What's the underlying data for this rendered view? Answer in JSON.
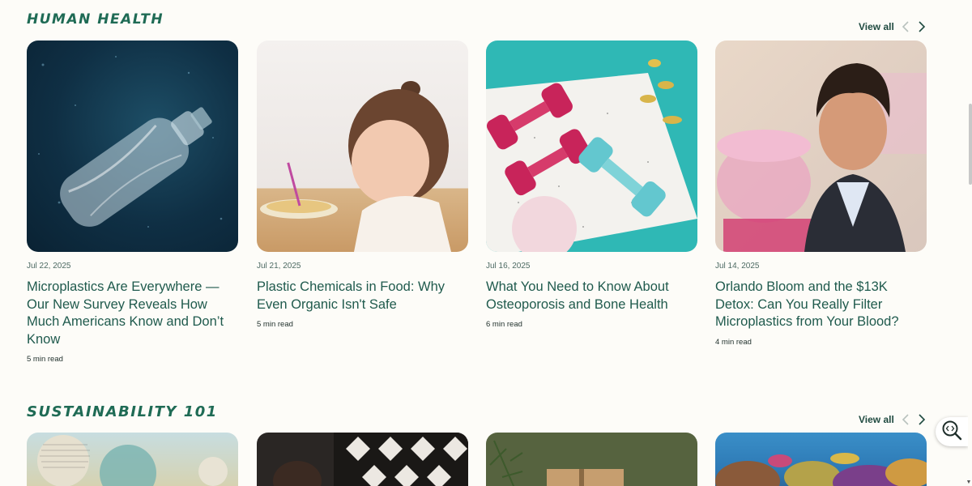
{
  "sections": [
    {
      "title": "HUMAN HEALTH",
      "view_all": "View all",
      "cards": [
        {
          "date": "Jul 22, 2025",
          "title": "Microplastics Are Everywhere — Our New Survey Reveals How Much Americans Know and Don’t Know",
          "read": "5 min read",
          "image": "plastic-bottle-underwater"
        },
        {
          "date": "Jul 21, 2025",
          "title": "Plastic Chemicals in Food: Why Even Organic Isn't Safe",
          "read": "5 min read",
          "image": "toddler-eating"
        },
        {
          "date": "Jul 16, 2025",
          "title": "What You Need to Know About Osteoporosis and Bone Health",
          "read": "6 min read",
          "image": "dumbbells-supplements"
        },
        {
          "date": "Jul 14, 2025",
          "title": "Orlando Bloom and the $13K Detox: Can You Really Filter Microplastics from Your Blood?",
          "read": "4 min read",
          "image": "man-portrait-containers"
        }
      ]
    },
    {
      "title": "SUSTAINABILITY 101",
      "view_all": "View all",
      "cards": [
        {
          "image": "newspaper-collage"
        },
        {
          "image": "knit-sweater"
        },
        {
          "image": "wrapped-gift-pine"
        },
        {
          "image": "coral-reef"
        }
      ]
    }
  ],
  "icons": {
    "prev": "chevron-left-icon",
    "next": "chevron-right-icon",
    "floating": "search-code-icon"
  }
}
